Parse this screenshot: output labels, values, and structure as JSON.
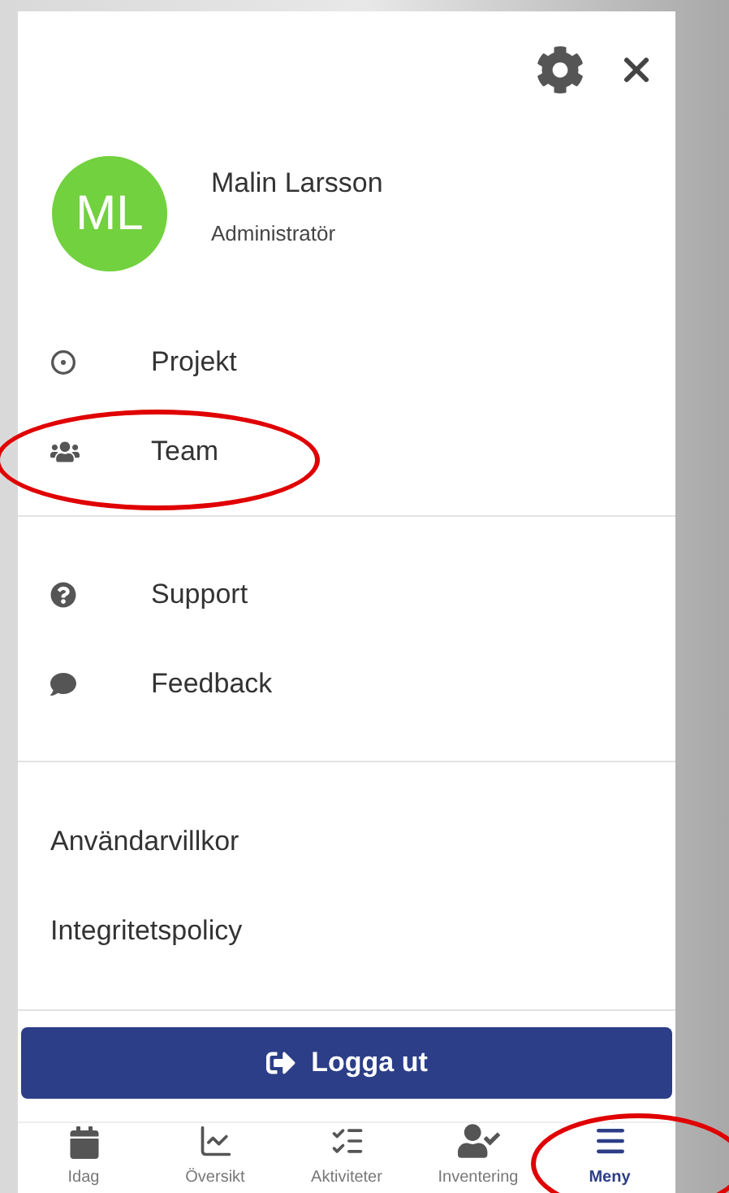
{
  "profile": {
    "initials": "ML",
    "name": "Malin Larsson",
    "role": "Administratör"
  },
  "primary_items": [
    {
      "kind": "target",
      "label": "Projekt",
      "annotated": false
    },
    {
      "kind": "team",
      "label": "Team",
      "annotated": true
    }
  ],
  "secondary_items": [
    {
      "kind": "help",
      "label": "Support"
    },
    {
      "kind": "comment",
      "label": "Feedback"
    }
  ],
  "links": [
    "Användarvillkor",
    "Integritetspolicy"
  ],
  "logout_button": "Logga ut",
  "bottom_nav": [
    {
      "kind": "calendar",
      "label": "Idag",
      "selected": false,
      "annotated": false
    },
    {
      "kind": "chart",
      "label": "Översikt",
      "selected": false,
      "annotated": false
    },
    {
      "kind": "checklist",
      "label": "Aktiviteter",
      "selected": false,
      "annotated": false
    },
    {
      "kind": "user",
      "label": "Inventering",
      "selected": false,
      "annotated": false
    },
    {
      "kind": "menu",
      "label": "Meny",
      "selected": true,
      "annotated": true
    }
  ]
}
